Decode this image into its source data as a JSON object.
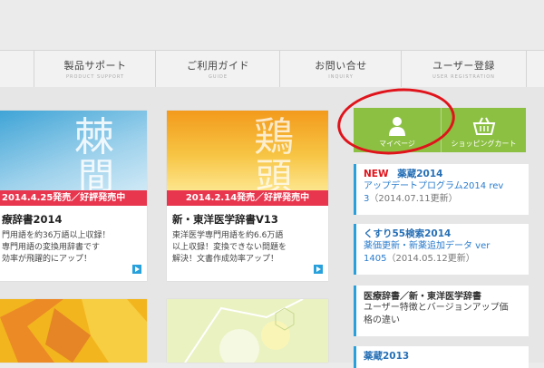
{
  "nav": {
    "items": [
      {
        "jp": "製品サポート",
        "en": "PRODUCT SUPPORT"
      },
      {
        "jp": "ご利用ガイド",
        "en": "GUIDE"
      },
      {
        "jp": "お問い合せ",
        "en": "INQUIRY"
      },
      {
        "jp": "ユーザー登録",
        "en": "USER REGISTRATION"
      }
    ]
  },
  "cards": [
    {
      "banner_kanji": "棘",
      "banner_kanji2": "間",
      "ribbon": "2014.4.25発売／好評発売中",
      "title": "療辞書2014",
      "desc": "門用語を約36万語以上収録！\n専門用語の変換用辞書です\n効率が飛躍的にアップ！"
    },
    {
      "banner_kanji": "鶏",
      "banner_kanji2": "頭",
      "ribbon": "2014.2.14発売／好評発売中",
      "title": "新・東洋医学辞書V13",
      "desc": "東洋医学専門用語を約6.6万語\n以上収録！変換できない問題を\n解決！文書作成効率アップ！"
    }
  ],
  "sidebar": {
    "mypage_label": "マイページ",
    "cart_label": "ショッピングカート",
    "news": [
      {
        "new_badge": "NEW",
        "title": "薬蔵2014",
        "body": "アップデートプログラム2014 rev\n3",
        "date": "（2014.07.11更新）"
      },
      {
        "title": "くすり55検索2014",
        "body": "薬価更新・新薬追加データ ver\n1405",
        "date": "（2014.05.12更新）"
      },
      {
        "title": "医療辞書／新・東洋医学辞書",
        "body": "ユーザー特徴とバージョンアップ価\n格の違い"
      },
      {
        "title": "薬蔵2013"
      }
    ]
  },
  "colors": {
    "accent_green": "#8cc043",
    "ribbon_red": "#e8364e",
    "link_blue": "#2a7ccd",
    "annotation_red": "#e0131b"
  }
}
